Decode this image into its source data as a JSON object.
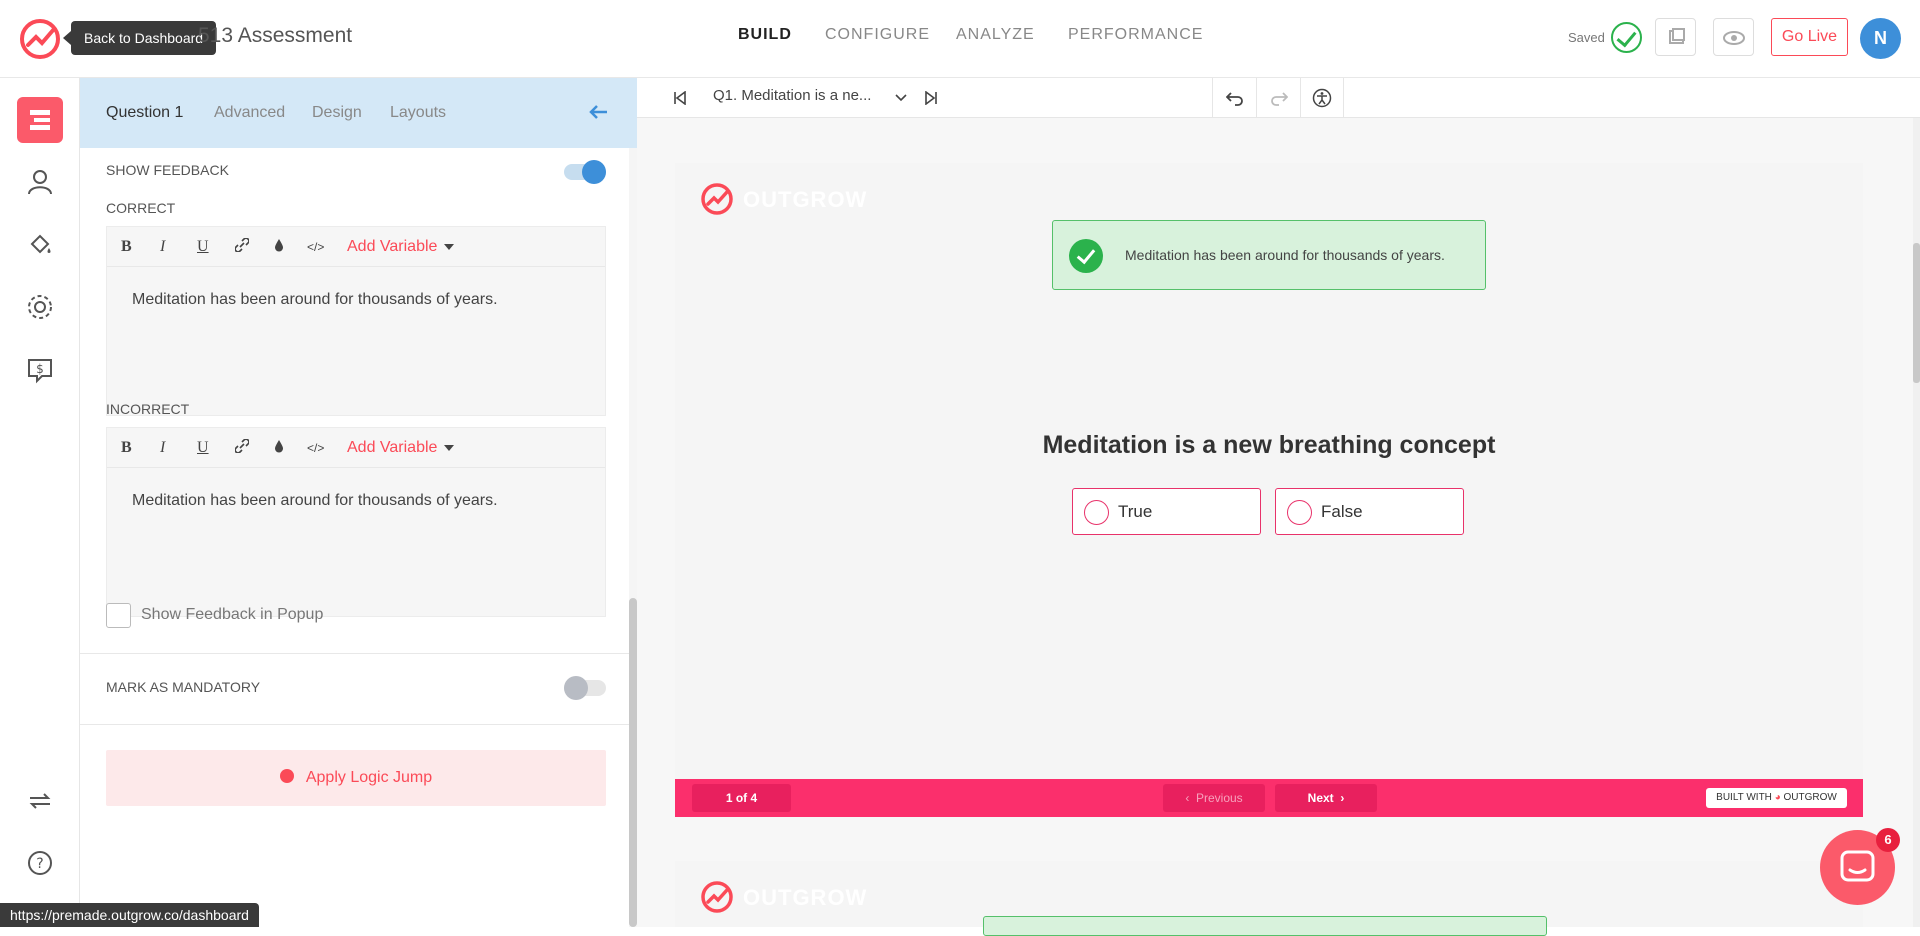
{
  "header": {
    "tooltip": "Back to Dashboard",
    "title": "513 Assessment",
    "nav": [
      "BUILD",
      "CONFIGURE",
      "ANALYZE",
      "PERFORMANCE"
    ],
    "saved_label": "Saved",
    "go_live": "Go Live",
    "avatar_initial": "N"
  },
  "panel": {
    "tabs": [
      "Question 1",
      "Advanced",
      "Design",
      "Layouts"
    ],
    "show_feedback": "SHOW FEEDBACK",
    "show_feedback_on": true,
    "correct_label": "CORRECT",
    "incorrect_label": "INCORRECT",
    "editor_tools": {
      "bold": "B",
      "italic": "I",
      "underline": "U",
      "add_variable": "Add Variable"
    },
    "correct_text": "Meditation has been around for thousands of years.",
    "incorrect_text": "Meditation has been around for thousands of years.",
    "popup_label": "Show Feedback in Popup",
    "mandatory_label": "MARK AS MANDATORY",
    "mandatory_on": false,
    "logic_jump": "Apply Logic Jump"
  },
  "status_url": "https://premade.outgrow.co/dashboard",
  "canvas": {
    "question_select": "Q1. Meditation is a ne...",
    "brand": "OUTGROW",
    "feedback": "Meditation has been around for thousands of years.",
    "question": "Meditation is a new breathing concept",
    "options": [
      "True",
      "False"
    ],
    "progress": "1 of 4",
    "previous": "Previous",
    "next": "Next",
    "built_with": "BUILT WITH",
    "built_brand": "OUTGROW"
  },
  "chat_badge": "6",
  "colors": {
    "accent": "#fb4a57",
    "footer": "#fb2f6c",
    "toggle_on": "#3d8fd9",
    "success": "#2bb24c"
  }
}
